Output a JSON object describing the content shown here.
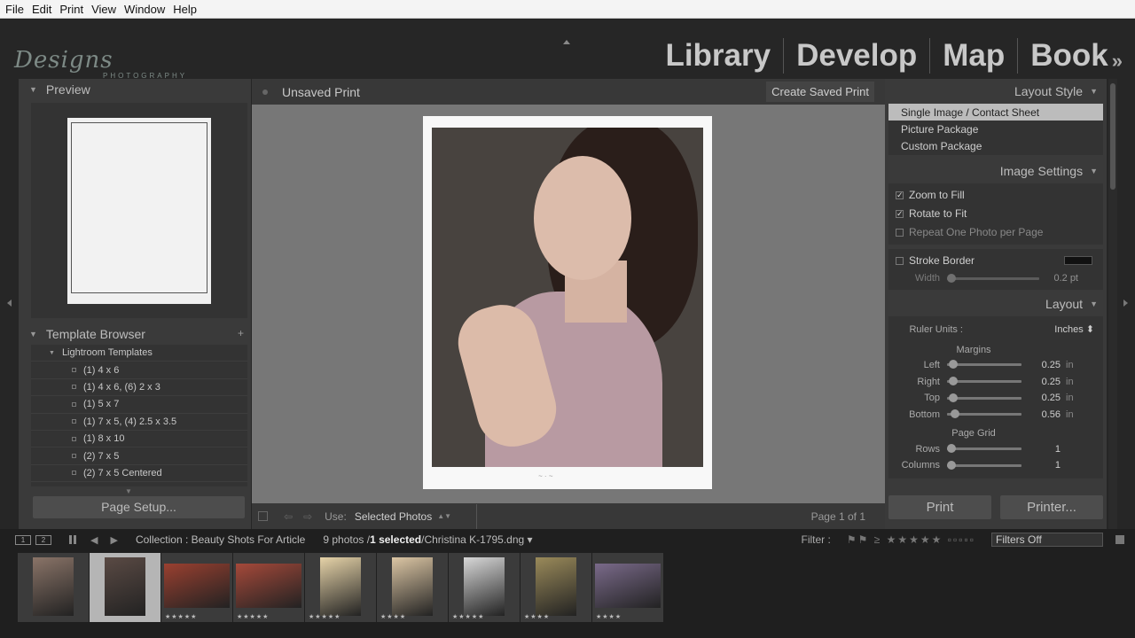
{
  "menu": [
    "File",
    "Edit",
    "Print",
    "View",
    "Window",
    "Help"
  ],
  "logo": {
    "main": "Designs",
    "sub": "PHOTOGRAPHY"
  },
  "modules": [
    "Library",
    "Develop",
    "Map",
    "Book"
  ],
  "module_more": "»",
  "left": {
    "preview_title": "Preview",
    "template_browser_title": "Template Browser",
    "folder": "Lightroom Templates",
    "templates": [
      "(1) 4 x 6",
      "(1) 4 x 6, (6) 2 x 3",
      "(1) 5 x 7",
      "(1) 7 x 5, (4) 2.5 x 3.5",
      "(1) 8 x 10",
      "(2) 7 x 5",
      "(2) 7 x 5 Centered"
    ],
    "page_setup": "Page Setup..."
  },
  "center": {
    "title": "Unsaved Print",
    "create_saved": "Create Saved Print",
    "use_label": "Use:",
    "use_value": "Selected Photos",
    "page": "Page 1 of 1"
  },
  "right": {
    "layout_style_title": "Layout Style",
    "layout_styles": [
      "Single Image / Contact Sheet",
      "Picture Package",
      "Custom Package"
    ],
    "image_settings_title": "Image Settings",
    "zoom_to_fill": "Zoom to Fill",
    "rotate_to_fit": "Rotate to Fit",
    "repeat_one": "Repeat One Photo per Page",
    "stroke_border": "Stroke Border",
    "width_label": "Width",
    "width_value": "0.2 pt",
    "layout_title": "Layout",
    "ruler_units_label": "Ruler Units :",
    "ruler_units_value": "Inches",
    "margins_title": "Margins",
    "margins": [
      {
        "label": "Left",
        "value": "0.25",
        "unit": "in"
      },
      {
        "label": "Right",
        "value": "0.25",
        "unit": "in"
      },
      {
        "label": "Top",
        "value": "0.25",
        "unit": "in"
      },
      {
        "label": "Bottom",
        "value": "0.56",
        "unit": "in"
      }
    ],
    "page_grid_title": "Page Grid",
    "grid": [
      {
        "label": "Rows",
        "value": "1"
      },
      {
        "label": "Columns",
        "value": "1"
      }
    ],
    "print_button": "Print",
    "printer_button": "Printer..."
  },
  "filmbar": {
    "box1": "1",
    "box2": "2",
    "collection": "Collection : Beauty Shots For Article",
    "count_pre": "9 photos /",
    "count_sel": "1 selected",
    "file": "/Christina K-1795.dng",
    "filter_label": "Filter :",
    "filters_off": "Filters Off"
  },
  "filmstrip": [
    {
      "selected": false,
      "stars": "",
      "color": "#8a7468"
    },
    {
      "selected": true,
      "stars": "",
      "color": "#5a4a44"
    },
    {
      "selected": false,
      "stars": "★★★★★",
      "color": "#9a4030"
    },
    {
      "selected": false,
      "stars": "★★★★★",
      "color": "#a5493a"
    },
    {
      "selected": false,
      "stars": "★★★★★",
      "color": "#e6d3a8"
    },
    {
      "selected": false,
      "stars": "★★★★",
      "color": "#dcc6a4"
    },
    {
      "selected": false,
      "stars": "★★★★★",
      "color": "#d8d8d8"
    },
    {
      "selected": false,
      "stars": "★★★★",
      "color": "#9a8a5a"
    },
    {
      "selected": false,
      "stars": "★★★★",
      "color": "#7a6a8a"
    }
  ]
}
